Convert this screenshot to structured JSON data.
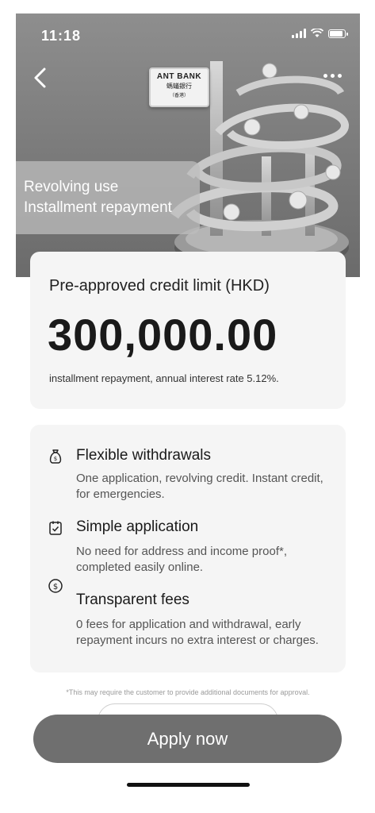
{
  "status_bar": {
    "time": "11:18"
  },
  "hero": {
    "bank_sign": {
      "english": "ANT BANK",
      "chinese": "螞蟻銀行",
      "region": "（香港）"
    },
    "tagline_line1": "Revolving use",
    "tagline_line2": "Installment repayment"
  },
  "credit": {
    "label": "Pre-approved credit limit (HKD)",
    "amount": "300,000.00",
    "note": "installment repayment, annual interest rate 5.12%."
  },
  "features": [
    {
      "icon": "money-bag-icon",
      "title": "Flexible withdrawals",
      "desc": "One application, revolving credit. Instant credit, for emergencies."
    },
    {
      "icon": "clipboard-check-icon",
      "title": "Simple application",
      "desc": "No need for address and income proof*, completed easily online."
    },
    {
      "icon": "dollar-coin-icon",
      "title": "Transparent fees",
      "desc": "0 fees for application and withdrawal, early repayment incurs no extra interest or charges."
    }
  ],
  "disclaimer": "*This may require the customer to provide additional documents for approval.",
  "apply_label": "Apply now",
  "colors": {
    "primary_button": "#6f6f6f",
    "card_bg": "#f5f5f5",
    "hero_bg": "#7a7a7a"
  }
}
